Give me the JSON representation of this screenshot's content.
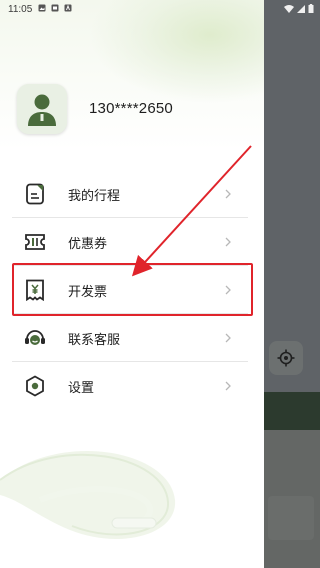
{
  "status_bar": {
    "time": "11:05"
  },
  "profile": {
    "phone": "130****2650"
  },
  "menu": {
    "items": [
      {
        "label": "我的行程",
        "icon": "itinerary-icon"
      },
      {
        "label": "优惠券",
        "icon": "coupon-icon"
      },
      {
        "label": "开发票",
        "icon": "invoice-icon"
      },
      {
        "label": "联系客服",
        "icon": "customer-service-icon"
      },
      {
        "label": "设置",
        "icon": "settings-icon"
      }
    ]
  },
  "annotation": {
    "highlight_color": "#e0242b",
    "highlighted_item": "开发票"
  },
  "colors": {
    "icon_dark": "#2a2a2a",
    "accent_green": "#4a6b3c",
    "chevron": "#b8b8b8"
  }
}
